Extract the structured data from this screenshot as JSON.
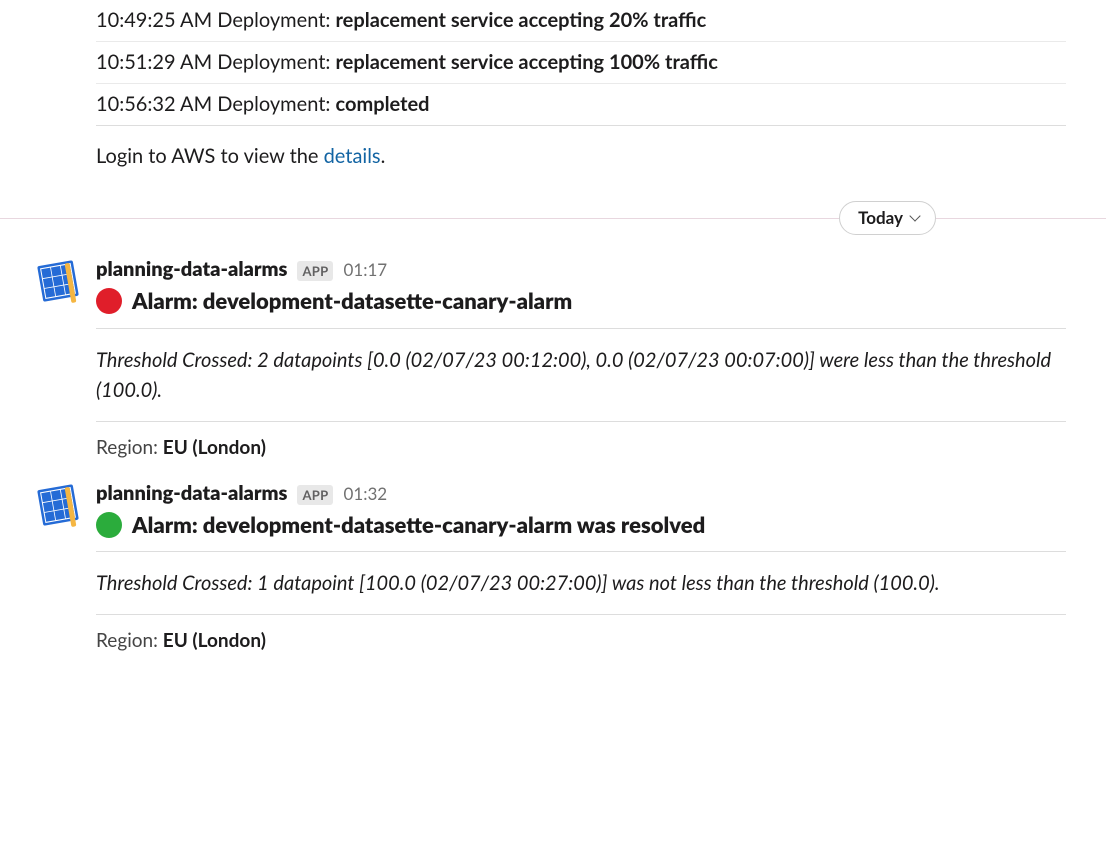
{
  "deployment_logs": [
    {
      "time": "10:49:25 AM",
      "prefix": "Deployment:",
      "detail": "replacement service accepting 20% traffic"
    },
    {
      "time": "10:51:29 AM",
      "prefix": "Deployment:",
      "detail": "replacement service accepting 100% traffic"
    },
    {
      "time": "10:56:32 AM",
      "prefix": "Deployment:",
      "detail": "completed"
    }
  ],
  "login_line": {
    "prefix": "Login to AWS to view the ",
    "link_text": "details",
    "suffix": "."
  },
  "date_divider": "Today",
  "messages": [
    {
      "sender": "planning-data-alarms",
      "badge": "APP",
      "time": "01:17",
      "status": "red",
      "title": "Alarm: development-datasette-canary-alarm",
      "threshold": "Threshold Crossed: 2 datapoints [0.0 (02/07/23 00:12:00), 0.0 (02/07/23 00:07:00)] were less than the threshold (100.0).",
      "region_label": "Region:",
      "region_value": "EU (London)"
    },
    {
      "sender": "planning-data-alarms",
      "badge": "APP",
      "time": "01:32",
      "status": "green",
      "title": "Alarm: development-datasette-canary-alarm was resolved",
      "threshold": "Threshold Crossed: 1 datapoint [100.0 (02/07/23 00:27:00)] was not less than the threshold (100.0).",
      "region_label": "Region:",
      "region_value": "EU (London)"
    }
  ]
}
